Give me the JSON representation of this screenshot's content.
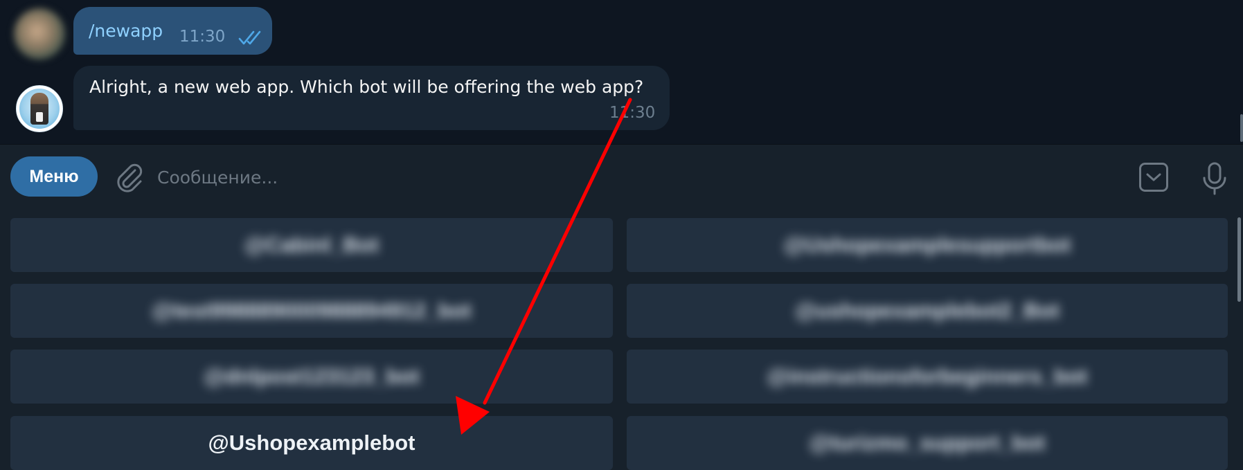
{
  "messages": [
    {
      "direction": "outgoing",
      "text": "/newapp",
      "time": "11:30",
      "status": "read-double-check-icon"
    },
    {
      "direction": "incoming",
      "text": "Alright, a new web app. Which bot will be offering the web app?",
      "time": "11:30"
    }
  ],
  "input_bar": {
    "menu_label": "Меню",
    "placeholder": "Сообщение...",
    "attach_icon": "paperclip-icon",
    "keyboard_icon": "chevron-down-box-icon",
    "mic_icon": "microphone-icon"
  },
  "keyboard": {
    "buttons": [
      {
        "label": "@Cabinl_Bot",
        "blurred": true
      },
      {
        "label": "@Ushopexamplesupportbot",
        "blurred": true
      },
      {
        "label": "@test998889000988894912_bot",
        "blurred": true
      },
      {
        "label": "@ushopexamplebot2_Bot",
        "blurred": true
      },
      {
        "label": "@dnlpost123123_bot",
        "blurred": true
      },
      {
        "label": "@instructionsforbeginners_bot",
        "blurred": true
      },
      {
        "label": "@Ushopexamplebot",
        "blurred": false
      },
      {
        "label": "@turizmo_support_bot",
        "blurred": true
      }
    ]
  },
  "colors": {
    "chat_bg": "#0e1621",
    "panel_bg": "#17212b",
    "outgoing_bubble": "#2b5278",
    "incoming_bubble": "#182533",
    "menu_button": "#2f6ea5",
    "annotation_arrow": "#ff0000"
  }
}
